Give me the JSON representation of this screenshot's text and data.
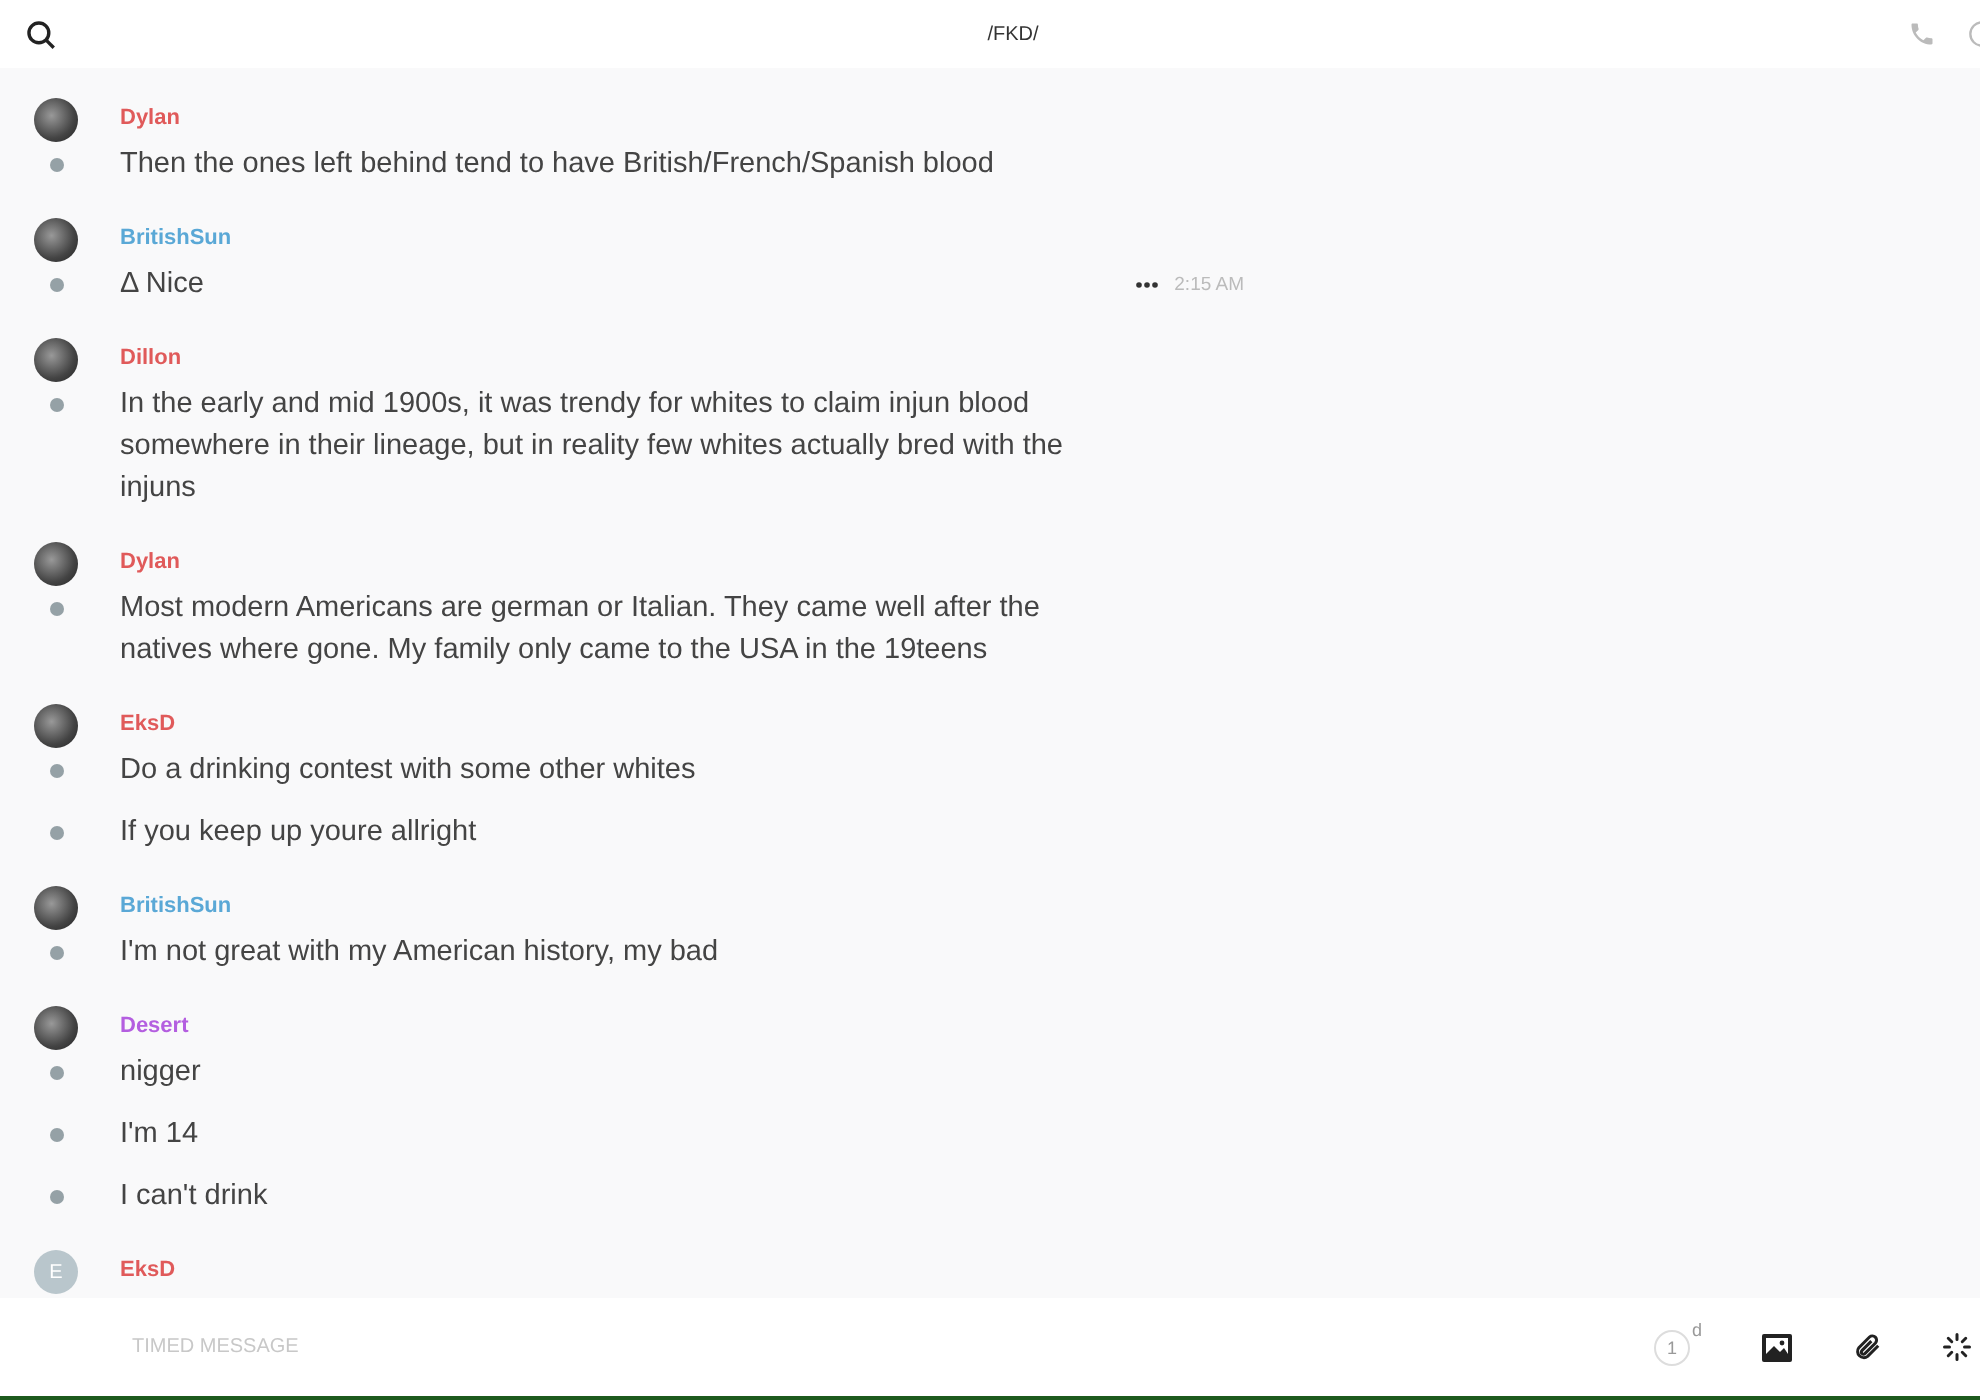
{
  "header": {
    "title": "/FKD/"
  },
  "groups": [
    {
      "author": "Dylan",
      "color": "#e05a5a",
      "messages": [
        {
          "text": "Then the ones left behind tend to have British/French/Spanish blood"
        }
      ]
    },
    {
      "author": "BritishSun",
      "color": "#5aa8d6",
      "messages": [
        {
          "text": "Δ Nice",
          "time": "2:15 AM"
        }
      ]
    },
    {
      "author": "Dillon",
      "color": "#e05a5a",
      "messages": [
        {
          "text": "In the early and mid 1900s, it was trendy for whites to claim injun blood somewhere in their lineage, but in reality few whites actually bred with the injuns"
        }
      ]
    },
    {
      "author": "Dylan",
      "color": "#e05a5a",
      "messages": [
        {
          "text": "Most modern Americans are german or Italian. They came well after the natives where gone. My family only came to the USA in the 19teens"
        }
      ]
    },
    {
      "author": "EksD",
      "color": "#e05a5a",
      "messages": [
        {
          "text": "Do a drinking contest with some other whites"
        },
        {
          "text": "If you keep up youre allright"
        }
      ]
    },
    {
      "author": "BritishSun",
      "color": "#5aa8d6",
      "messages": [
        {
          "text": "I'm not great with my American history, my bad"
        }
      ]
    },
    {
      "author": "Desert",
      "color": "#b45ee0",
      "messages": [
        {
          "text": "nigger"
        },
        {
          "text": "I'm 14"
        },
        {
          "text": "I can't drink"
        }
      ]
    },
    {
      "author": "EksD",
      "color": "#e05a5a",
      "initial": "E"
    }
  ],
  "composer": {
    "placeholder": "TIMED MESSAGE",
    "timer_value": "1",
    "timer_unit": "d"
  }
}
